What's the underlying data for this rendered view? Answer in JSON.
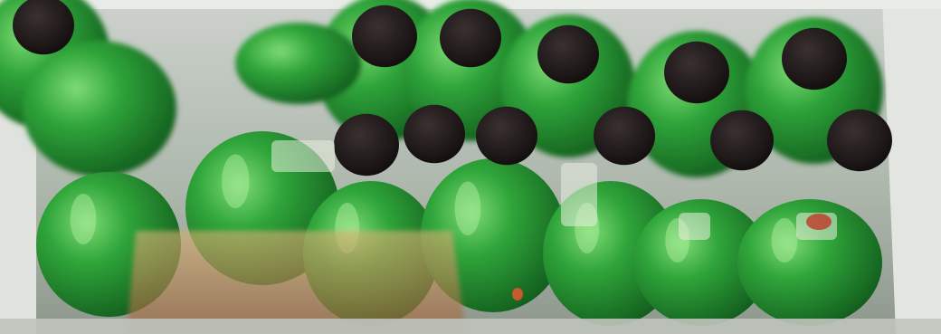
{
  "image": {
    "subject": "green-soda-bottles-in-refrigerator",
    "colors": {
      "background_fridge": "#d6d9d4",
      "bottle_green": "#1f8a2e",
      "bottle_highlight": "#6fd06b",
      "cap_black": "#1a1414",
      "shelf_white": "#e6e8e3",
      "amber_reflection": "#c8a061"
    }
  }
}
